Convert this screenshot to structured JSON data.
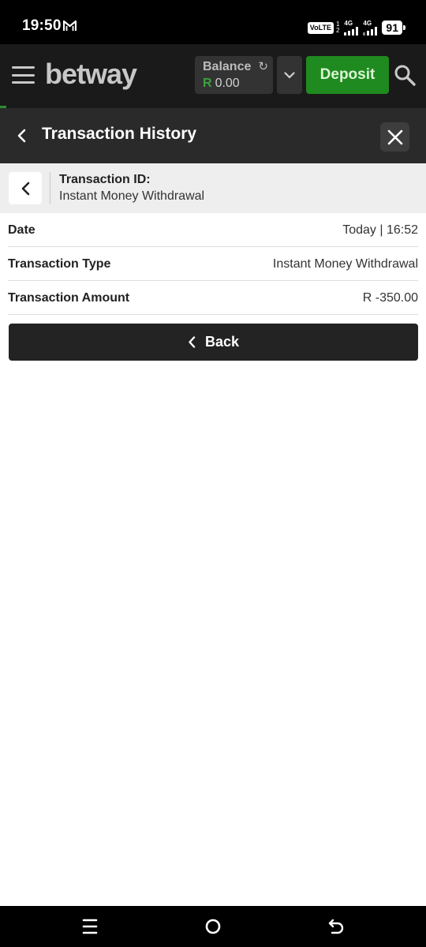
{
  "status_bar": {
    "time": "19:50",
    "volte": "VoLTE",
    "sim_numbers": [
      "1",
      "2"
    ],
    "network_1": "4G",
    "network_2": "4G",
    "battery": "91"
  },
  "header": {
    "logo": "betway",
    "balance_label": "Balance",
    "currency": "R",
    "balance_amount": "0.00",
    "deposit_label": "Deposit"
  },
  "page": {
    "title": "Transaction History"
  },
  "transaction": {
    "id_label": "Transaction ID:",
    "id_value": "Instant Money Withdrawal",
    "rows": [
      {
        "label": "Date",
        "value": "Today | 16:52"
      },
      {
        "label": "Transaction Type",
        "value": "Instant Money Withdrawal"
      },
      {
        "label": "Transaction Amount",
        "value": "R -350.00"
      }
    ],
    "back_label": "Back"
  },
  "colors": {
    "brand_green": "#1f8a1f",
    "header_bg": "#1a1a1a"
  },
  "icons": [
    "mail-icon",
    "menu-icon",
    "refresh-icon",
    "chevron-down-icon",
    "search-icon",
    "chevron-left-icon",
    "close-icon",
    "recent-apps-icon",
    "home-icon",
    "back-nav-icon"
  ]
}
